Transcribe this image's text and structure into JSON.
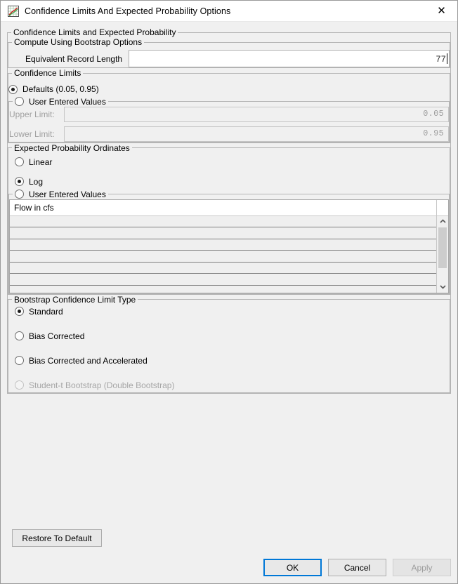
{
  "window": {
    "title": "Confidence Limits And Expected Probability Options",
    "icon": "chart-plot-icon",
    "close_icon": "close-icon"
  },
  "outer_group": {
    "legend": "Confidence Limits and Expected Probability"
  },
  "bootstrap_options": {
    "legend": "Compute Using Bootstrap Options",
    "equivalent_record_length": {
      "label": "Equivalent Record Length",
      "value": "77",
      "placeholder": ""
    }
  },
  "confidence_limits": {
    "legend": "Confidence Limits",
    "defaults_option": {
      "label": "Defaults (0.05, 0.95)",
      "checked": true
    },
    "user_entered": {
      "label": "User Entered Values",
      "checked": false,
      "upper": {
        "label": "Upper Limit:",
        "value": "0.05",
        "enabled": false
      },
      "lower": {
        "label": "Lower Limit:",
        "value": "0.95",
        "enabled": false
      }
    }
  },
  "expected_probability": {
    "legend": "Expected Probability Ordinates",
    "options": [
      {
        "label": "Linear",
        "checked": false
      },
      {
        "label": "Log",
        "checked": true
      }
    ],
    "user_entered": {
      "label": "User Entered Values",
      "checked": false,
      "table": {
        "column_header": "Flow in cfs",
        "rows": [
          "",
          "",
          "",
          "",
          "",
          "",
          "",
          ""
        ]
      },
      "scrollbar": {
        "up_icon": "chevron-up-icon",
        "down_icon": "chevron-down-icon"
      }
    }
  },
  "bootstrap_limit_type": {
    "legend": "Bootstrap Confidence Limit Type",
    "options": [
      {
        "label": "Standard",
        "checked": true,
        "enabled": true
      },
      {
        "label": "Bias Corrected",
        "checked": false,
        "enabled": true
      },
      {
        "label": "Bias Corrected and Accelerated",
        "checked": false,
        "enabled": true
      },
      {
        "label": "Student-t Bootstrap (Double Bootstrap)",
        "checked": false,
        "enabled": false
      }
    ]
  },
  "buttons": {
    "restore": {
      "label": "Restore To Default",
      "enabled": true
    },
    "ok": {
      "label": "OK",
      "enabled": true,
      "focused": true
    },
    "cancel": {
      "label": "Cancel",
      "enabled": true
    },
    "apply": {
      "label": "Apply",
      "enabled": false
    }
  },
  "colors": {
    "dialog_bg": "#f0f0f0",
    "titlebar_bg": "#ffffff",
    "focus_accent": "#0078d7",
    "disabled_text": "#a0a0a0",
    "group_border": "#b4b4b4"
  }
}
